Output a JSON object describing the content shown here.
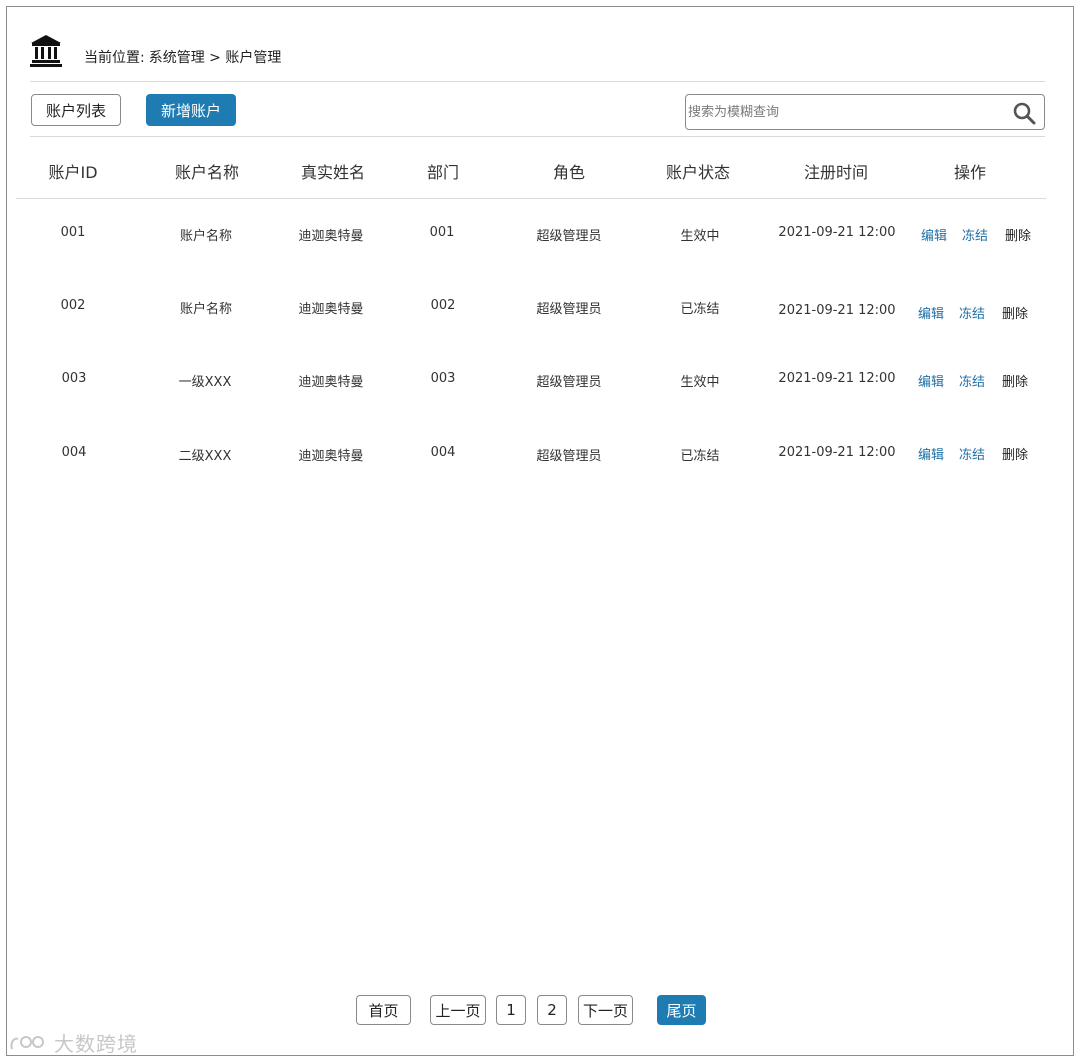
{
  "breadcrumb": {
    "prefix": "当前位置:",
    "path": "系统管理 > 账户管理"
  },
  "toolbar": {
    "list_label": "账户列表",
    "add_label": "新增账户",
    "search_placeholder": "搜索为模糊查询"
  },
  "table": {
    "headers": [
      "账户ID",
      "账户名称",
      "真实姓名",
      "部门",
      "角色",
      "账户状态",
      "注册时间",
      "操作"
    ],
    "rows": [
      {
        "id": "001",
        "name": "账户名称",
        "real_name": "迪迦奥特曼",
        "dept": "001",
        "role": "超级管理员",
        "status": "生效中",
        "time": "2021-09-21 12:00",
        "edit": "编辑",
        "freeze": "冻结",
        "delete": "删除"
      },
      {
        "id": "002",
        "name": "账户名称",
        "real_name": "迪迦奥特曼",
        "dept": "002",
        "role": "超级管理员",
        "status": "已冻结",
        "time": "2021-09-21 12:00",
        "edit": "编辑",
        "freeze": "冻结",
        "delete": "删除"
      },
      {
        "id": "003",
        "name": "一级XXX",
        "real_name": "迪迦奥特曼",
        "dept": "003",
        "role": "超级管理员",
        "status": "生效中",
        "time": "2021-09-21 12:00",
        "edit": "编辑",
        "freeze": "冻结",
        "delete": "删除"
      },
      {
        "id": "004",
        "name": "二级XXX",
        "real_name": "迪迦奥特曼",
        "dept": "004",
        "role": "超级管理员",
        "status": "已冻结",
        "time": "2021-09-21 12:00",
        "edit": "编辑",
        "freeze": "冻结",
        "delete": "删除"
      }
    ]
  },
  "pagination": {
    "first": "首页",
    "prev": "上一页",
    "pages": [
      "1",
      "2"
    ],
    "next": "下一页",
    "last": "尾页"
  },
  "watermark": "大数跨境",
  "colors": {
    "accent": "#1f7cb3",
    "link": "#1f6fa5"
  }
}
